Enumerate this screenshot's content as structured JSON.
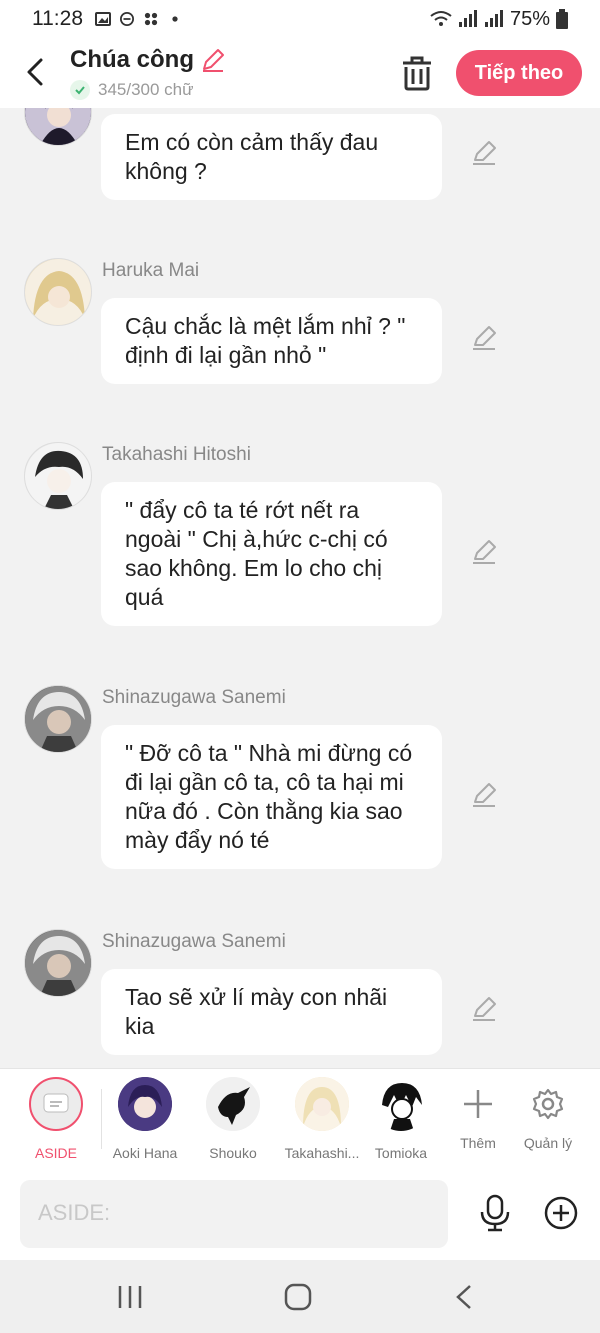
{
  "status": {
    "time": "11:28",
    "battery": "75%"
  },
  "header": {
    "title": "Chúa công",
    "counter": "345/300 chữ",
    "next_label": "Tiếp theo"
  },
  "messages": [
    {
      "sender": "",
      "text": "Em có còn cảm thấy đau không ?",
      "avatar_color": "#2b2440"
    },
    {
      "sender": "Haruka Mai",
      "text": "Cậu chắc là mệt lắm nhỉ ? \" định đi lại gần nhỏ \"",
      "avatar_color": "#e9dcc0"
    },
    {
      "sender": "Takahashi Hitoshi",
      "text": "\" đẩy cô ta té rớt nết ra ngoài \" Chị à,hức c-chị có sao không. Em lo cho chị quá",
      "avatar_color": "#e8e8e8"
    },
    {
      "sender": "Shinazugawa Sanemi",
      "text": "\" Đỡ cô ta \" Nhà mi đừng có đi lại gần cô ta, cô ta hại mi nữa đó . Còn thằng kia sao mày đẩy nó té",
      "avatar_color": "#6b6b6b"
    },
    {
      "sender": "Shinazugawa Sanemi",
      "text": "Tao sẽ xử lí mày con nhãi kia",
      "avatar_color": "#6b6b6b"
    }
  ],
  "characters": [
    {
      "label": "ASIDE",
      "color": "#ececec"
    },
    {
      "label": "Aoki Hana",
      "color": "#3b2a6b"
    },
    {
      "label": "Shouko",
      "color": "#f4f4f4"
    },
    {
      "label": "Takahashi...",
      "color": "#f3e6c8"
    },
    {
      "label": "Tomioka",
      "color": "#ffffff"
    },
    {
      "label": "Thêm"
    },
    {
      "label": "Quản lý"
    }
  ],
  "input": {
    "placeholder": "ASIDE:"
  },
  "colors": {
    "accent": "#f0506e",
    "background": "#f2f2f2"
  }
}
